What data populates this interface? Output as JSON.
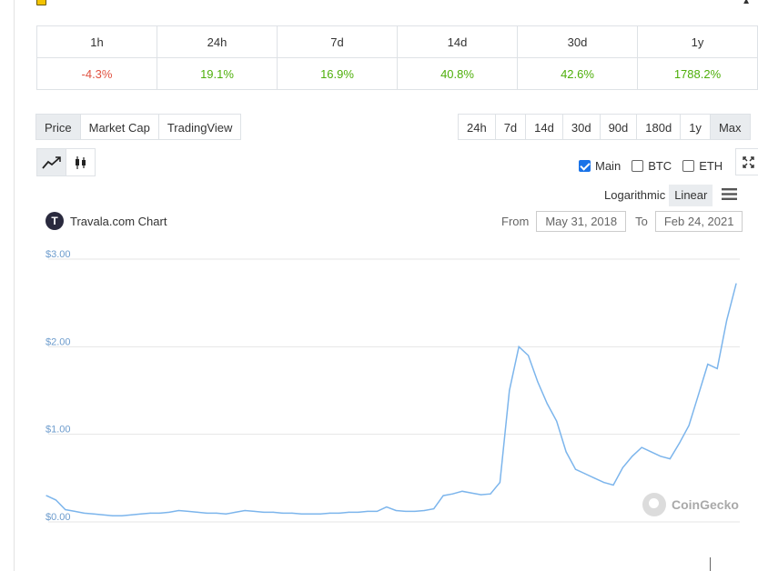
{
  "change_table": {
    "periods": [
      "1h",
      "24h",
      "7d",
      "14d",
      "30d",
      "1y"
    ],
    "values": [
      "-4.3%",
      "19.1%",
      "16.9%",
      "40.8%",
      "42.6%",
      "1788.2%"
    ]
  },
  "chart_tabs": {
    "price": "Price",
    "market_cap": "Market Cap",
    "tradingview": "TradingView"
  },
  "range_buttons": [
    "24h",
    "7d",
    "14d",
    "30d",
    "90d",
    "180d",
    "1y",
    "Max"
  ],
  "chart_type_icons": [
    "line-chart-icon",
    "candlestick-icon"
  ],
  "compare": {
    "main": "Main",
    "btc": "BTC",
    "eth": "ETH"
  },
  "scale": {
    "log": "Logarithmic",
    "linear": "Linear"
  },
  "chart_title": "Travala.com Chart",
  "date_range": {
    "from_label": "From",
    "from_value": "May 31, 2018",
    "to_label": "To",
    "to_value": "Feb 24, 2021"
  },
  "watermark": "CoinGecko",
  "colors": {
    "line": "#7cb5ec",
    "negative": "#e15241",
    "positive": "#4eaf0a",
    "axis_label": "#6d9ccd"
  },
  "chart_data": {
    "type": "line",
    "x_start": "May 31, 2018",
    "x_end": "Feb 24, 2021",
    "ylim": [
      0,
      3
    ],
    "y_ticks": [
      "$0.00",
      "$1.00",
      "$2.00",
      "$3.00"
    ],
    "series": [
      {
        "values": [
          0.3,
          0.25,
          0.14,
          0.12,
          0.1,
          0.09,
          0.08,
          0.07,
          0.07,
          0.08,
          0.09,
          0.1,
          0.1,
          0.11,
          0.13,
          0.12,
          0.11,
          0.1,
          0.1,
          0.09,
          0.11,
          0.13,
          0.12,
          0.11,
          0.11,
          0.1,
          0.1,
          0.09,
          0.09,
          0.09,
          0.1,
          0.1,
          0.11,
          0.11,
          0.12,
          0.12,
          0.17,
          0.13,
          0.12,
          0.12,
          0.13,
          0.15,
          0.3,
          0.32,
          0.35,
          0.33,
          0.31,
          0.32,
          0.45,
          1.5,
          2.0,
          1.9,
          1.6,
          1.35,
          1.15,
          0.8,
          0.6,
          0.55,
          0.5,
          0.45,
          0.42,
          0.62,
          0.75,
          0.85,
          0.8,
          0.75,
          0.72,
          0.9,
          1.1,
          1.45,
          1.8,
          1.75,
          2.3,
          2.72
        ]
      }
    ]
  }
}
